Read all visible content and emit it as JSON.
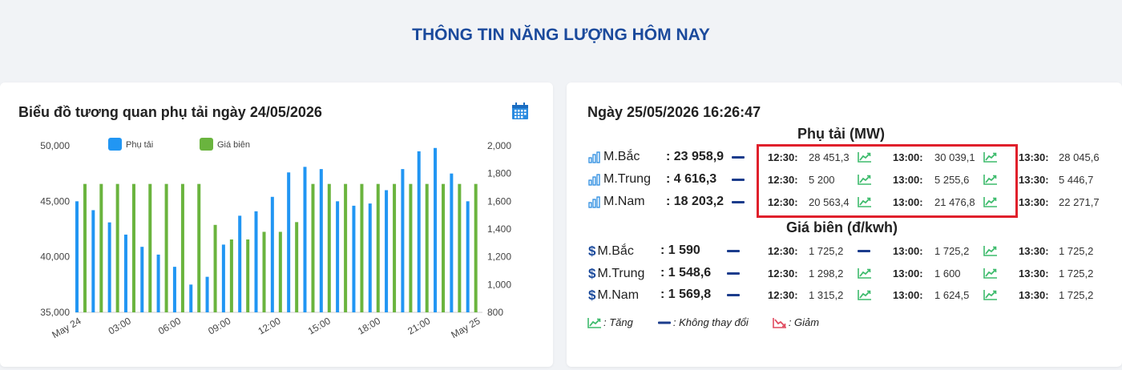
{
  "page_title": "THÔNG TIN NĂNG LƯỢNG HÔM NAY",
  "chart_card": {
    "title": "Biểu đồ tương quan phụ tải ngày 24/05/2026",
    "calendar_icon": "calendar-icon"
  },
  "chart_data": {
    "type": "bar",
    "title": "Biểu đồ tương quan phụ tải ngày 24/05/2026",
    "x_tick_labels": [
      "May 24",
      "03:00",
      "06:00",
      "09:00",
      "12:00",
      "15:00",
      "18:00",
      "21:00",
      "May 25"
    ],
    "y_left_ticks": [
      "35,000",
      "40,000",
      "45,000",
      "50,000"
    ],
    "y_right_ticks": [
      "800",
      "1,000",
      "1,200",
      "1,400",
      "1,600",
      "1,800",
      "2,000"
    ],
    "y_left_range": [
      35000,
      50000
    ],
    "y_right_range": [
      800,
      2000
    ],
    "grid": false,
    "legend_position": "top",
    "series": [
      {
        "name": "Phụ tải",
        "axis": "left",
        "color": "#2196f3",
        "values": [
          45000,
          44200,
          43100,
          42000,
          40900,
          40200,
          39100,
          37500,
          38200,
          41100,
          43700,
          44100,
          45400,
          47600,
          48100,
          47900,
          45000,
          44600,
          44800,
          46000,
          47900,
          49500,
          49800,
          47500,
          45000
        ]
      },
      {
        "name": "Giá biên",
        "axis": "right",
        "color": "#6ab43e",
        "values": [
          1725,
          1725,
          1725,
          1725,
          1725,
          1725,
          1725,
          1725,
          1430,
          1325,
          1325,
          1380,
          1380,
          1450,
          1725,
          1725,
          1725,
          1725,
          1725,
          1725,
          1725,
          1725,
          1725,
          1725,
          1725
        ]
      }
    ]
  },
  "info_card": {
    "datetime": "Ngày 25/05/2026 16:26:47",
    "load_title": "Phụ tải (MW)",
    "price_title": "Giá biên (đ/kwh)",
    "load_rows": [
      {
        "region": "M.Bắc",
        "current": ": 23 958,9",
        "trend": "flat",
        "slots": [
          {
            "t": "12:30:",
            "v": "28 451,3",
            "trend": "up"
          },
          {
            "t": "13:00:",
            "v": "30 039,1",
            "trend": "up"
          },
          {
            "t": "13:30:",
            "v": "28 045,6"
          }
        ]
      },
      {
        "region": "M.Trung",
        "current": ": 4 616,3",
        "trend": "flat",
        "slots": [
          {
            "t": "12:30:",
            "v": "5 200",
            "trend": "up"
          },
          {
            "t": "13:00:",
            "v": "5 255,6",
            "trend": "up"
          },
          {
            "t": "13:30:",
            "v": "5 446,7"
          }
        ]
      },
      {
        "region": "M.Nam",
        "current": ": 18 203,2",
        "trend": "flat",
        "slots": [
          {
            "t": "12:30:",
            "v": "20 563,4",
            "trend": "up"
          },
          {
            "t": "13:00:",
            "v": "21 476,8",
            "trend": "up"
          },
          {
            "t": "13:30:",
            "v": "22 271,7"
          }
        ]
      }
    ],
    "price_rows": [
      {
        "region": "M.Bắc",
        "current": ": 1 590",
        "trend": "flat",
        "slots": [
          {
            "t": "12:30:",
            "v": "1 725,2",
            "trend": "flat"
          },
          {
            "t": "13:00:",
            "v": "1 725,2",
            "trend": "up"
          },
          {
            "t": "13:30:",
            "v": "1 725,2"
          }
        ]
      },
      {
        "region": "M.Trung",
        "current": ": 1 548,6",
        "trend": "flat",
        "slots": [
          {
            "t": "12:30:",
            "v": "1 298,2",
            "trend": "up"
          },
          {
            "t": "13:00:",
            "v": "1 600",
            "trend": "up"
          },
          {
            "t": "13:30:",
            "v": "1 725,2"
          }
        ]
      },
      {
        "region": "M.Nam",
        "current": ": 1 569,8",
        "trend": "flat",
        "slots": [
          {
            "t": "12:30:",
            "v": "1 315,2",
            "trend": "up"
          },
          {
            "t": "13:00:",
            "v": "1 624,5",
            "trend": "up"
          },
          {
            "t": "13:30:",
            "v": "1 725,2"
          }
        ]
      }
    ],
    "legend": {
      "up": ": Tăng",
      "flat": ": Không thay đổi",
      "down": ": Giảm"
    },
    "colors": {
      "up": "#3dbb6c",
      "flat": "#1b3c8c",
      "down": "#e04a5f",
      "accent": "#1b4a9c"
    }
  }
}
